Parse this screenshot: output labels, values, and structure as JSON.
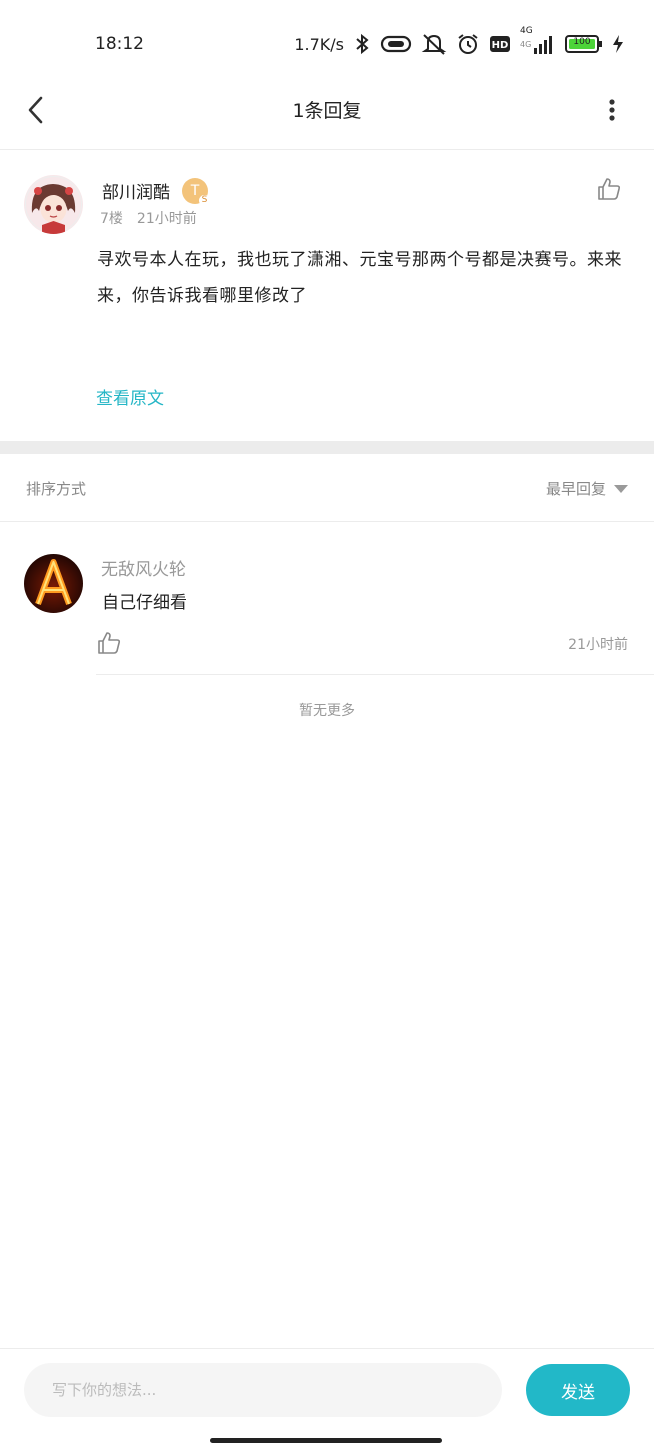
{
  "status_bar": {
    "time": "18:12",
    "network_speed": "1.7K/s",
    "signal_type_top": "4G",
    "signal_type_bottom": "4G",
    "battery": "100",
    "icons": [
      "bluetooth-icon",
      "link-icon",
      "mute-icon",
      "alarm-icon",
      "hd-icon",
      "signal-icon",
      "battery-icon",
      "charging-icon"
    ]
  },
  "header": {
    "title": "1条回复",
    "back_icon": "back-arrow-icon",
    "more_icon": "more-vertical-icon"
  },
  "original_comment": {
    "username": "部川润酷",
    "level_badge": "T",
    "level_sub": "S",
    "floor": "7楼",
    "time": "21小时前",
    "text": "寻欢号本人在玩，我也玩了潇湘、元宝号那两个号都是决赛号。来来来，你告诉我看哪里修改了",
    "view_original_label": "查看原文",
    "like_icon": "thumbs-up-icon"
  },
  "sort": {
    "label": "排序方式",
    "selected": "最早回复"
  },
  "replies": [
    {
      "username": "无敌风火轮",
      "text": "自己仔细看",
      "time": "21小时前",
      "like_icon": "thumbs-up-icon"
    }
  ],
  "no_more_text": "暂无更多",
  "composer": {
    "placeholder": "写下你的想法...",
    "send_label": "发送"
  },
  "colors": {
    "accent": "#22b8c8",
    "link": "#25b6c6",
    "divider": "#ececec",
    "muted_text": "#999999"
  }
}
